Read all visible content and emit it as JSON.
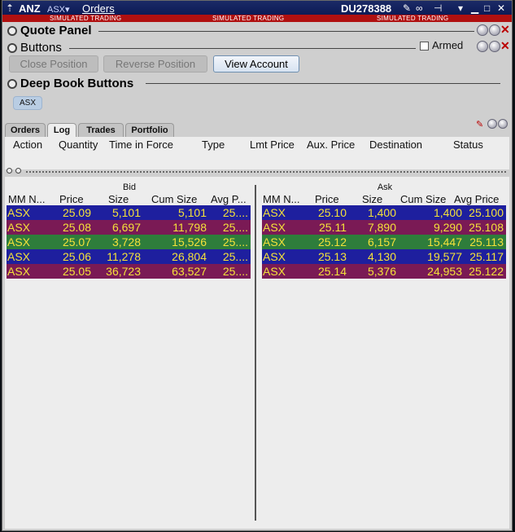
{
  "titlebar": {
    "symbol": "ANZ",
    "exchange": "ASX▾",
    "menu_orders": "Orders",
    "account": "DU278388",
    "sim_label": "SIMULATED TRADING"
  },
  "quote_panel": {
    "title": "Quote Panel"
  },
  "buttons_panel": {
    "title": "Buttons",
    "armed_label": "Armed",
    "close_position": "Close Position",
    "reverse_position": "Reverse Position",
    "view_account": "View Account"
  },
  "deep_book_buttons": {
    "title": "Deep Book Buttons",
    "chip": "ASX"
  },
  "tabs": [
    "Orders",
    "Log",
    "Trades",
    "Portfolio"
  ],
  "orders_columns": [
    "Action",
    "Quantity",
    "Time in Force",
    "Type",
    "Lmt Price",
    "Aux. Price",
    "Destination",
    "Status"
  ],
  "book": {
    "bid_title": "Bid",
    "ask_title": "Ask",
    "bid_columns": [
      "MM N...",
      "Price",
      "Size",
      "Cum Size",
      "Avg P..."
    ],
    "ask_columns": [
      "MM N...",
      "Price",
      "Size",
      "Cum Size",
      "Avg Price"
    ],
    "row_colors": [
      "#1e1f9e",
      "#7a1a55",
      "#2e7d3b",
      "#1e1f9e",
      "#7a1a55"
    ],
    "bids": [
      [
        "ASX",
        "25.09",
        "5,101",
        "5,101",
        "25...."
      ],
      [
        "ASX",
        "25.08",
        "6,697",
        "11,798",
        "25...."
      ],
      [
        "ASX",
        "25.07",
        "3,728",
        "15,526",
        "25...."
      ],
      [
        "ASX",
        "25.06",
        "11,278",
        "26,804",
        "25...."
      ],
      [
        "ASX",
        "25.05",
        "36,723",
        "63,527",
        "25...."
      ]
    ],
    "asks": [
      [
        "ASX",
        "25.10",
        "1,400",
        "1,400",
        "25.100"
      ],
      [
        "ASX",
        "25.11",
        "7,890",
        "9,290",
        "25.108"
      ],
      [
        "ASX",
        "25.12",
        "6,157",
        "15,447",
        "25.113"
      ],
      [
        "ASX",
        "25.13",
        "4,130",
        "19,577",
        "25.117"
      ],
      [
        "ASX",
        "25.14",
        "5,376",
        "24,953",
        "25.122"
      ]
    ]
  }
}
